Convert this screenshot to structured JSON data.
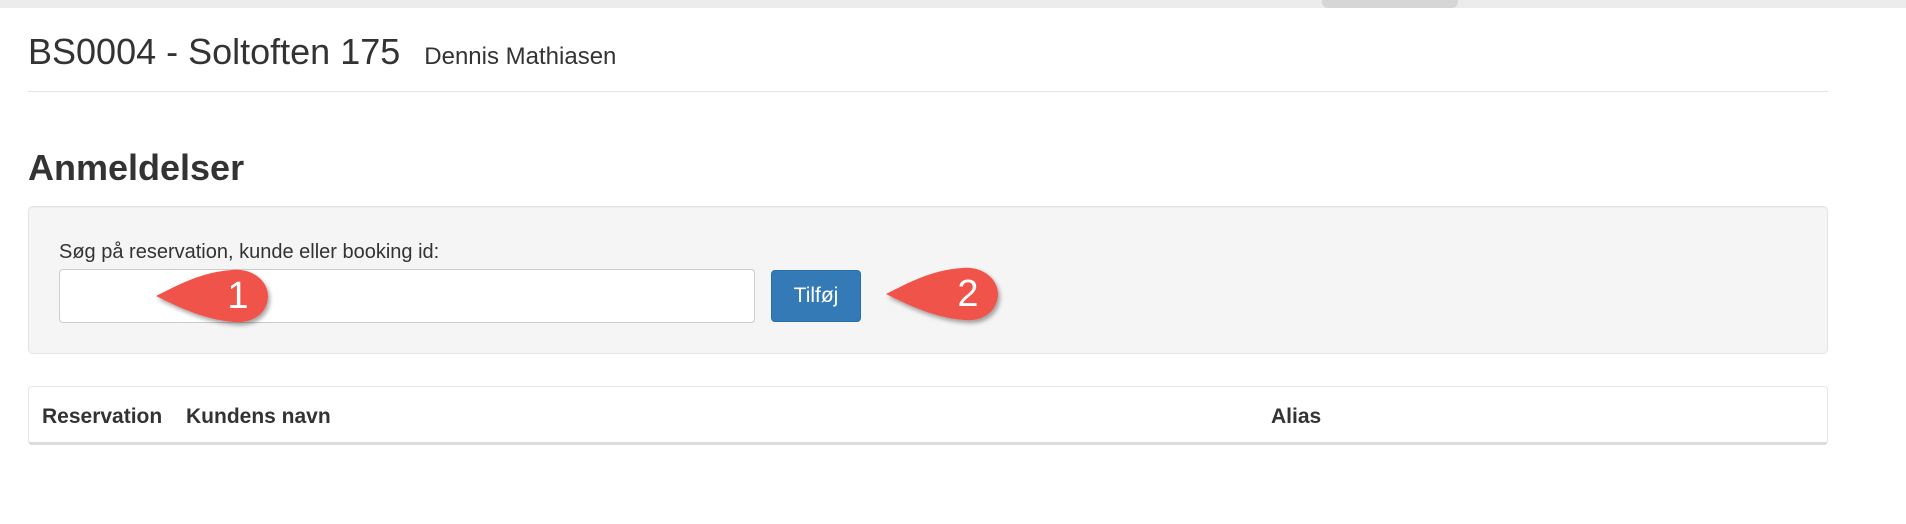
{
  "header": {
    "title": "BS0004 - Soltoften 175",
    "user": "Dennis Mathiasen"
  },
  "section": {
    "title": "Anmeldelser"
  },
  "search": {
    "label": "Søg på reservation, kunde eller booking id:",
    "value": "",
    "placeholder": "",
    "button_label": "Tilføj"
  },
  "table": {
    "columns": [
      "Reservation",
      "Kundens navn",
      "Alias"
    ],
    "rows": []
  },
  "callouts": [
    "1",
    "2"
  ],
  "colors": {
    "primary_button": "#337ab7",
    "callout": "#f0524a",
    "well_background": "#f5f5f5"
  }
}
